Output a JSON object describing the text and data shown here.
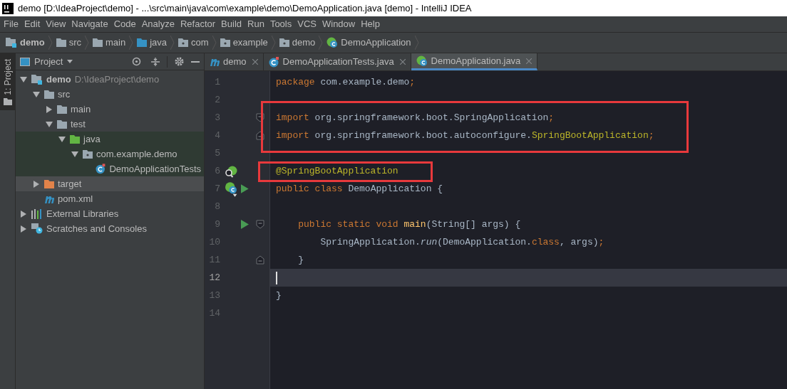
{
  "window": {
    "title": "demo [D:\\IdeaProject\\demo] - ...\\src\\main\\java\\com\\example\\demo\\DemoApplication.java [demo] - IntelliJ IDEA"
  },
  "menu": [
    "File",
    "Edit",
    "View",
    "Navigate",
    "Code",
    "Analyze",
    "Refactor",
    "Build",
    "Run",
    "Tools",
    "VCS",
    "Window",
    "Help"
  ],
  "breadcrumbs": [
    {
      "label": "demo",
      "kind": "module"
    },
    {
      "label": "src",
      "kind": "folder"
    },
    {
      "label": "main",
      "kind": "folder"
    },
    {
      "label": "java",
      "kind": "source"
    },
    {
      "label": "com",
      "kind": "package"
    },
    {
      "label": "example",
      "kind": "package"
    },
    {
      "label": "demo",
      "kind": "package"
    },
    {
      "label": "DemoApplication",
      "kind": "spring-class"
    }
  ],
  "tool_strip": {
    "label": "1: Project"
  },
  "project_panel": {
    "title": "Project",
    "tree": [
      {
        "label": "demo",
        "path": "D:\\IdeaProject\\demo",
        "kind": "module",
        "expanded": true,
        "selected": false,
        "children": [
          {
            "label": "src",
            "kind": "folder",
            "expanded": true,
            "selected": false,
            "children": [
              {
                "label": "main",
                "kind": "folder",
                "expanded": false,
                "selected": false
              },
              {
                "label": "test",
                "kind": "folder",
                "expanded": true,
                "selected": false,
                "children": [
                  {
                    "label": "java",
                    "kind": "test-source",
                    "expanded": true,
                    "selected": false,
                    "children": [
                      {
                        "label": "com.example.demo",
                        "kind": "package",
                        "expanded": true,
                        "selected": false,
                        "children": [
                          {
                            "label": "DemoApplicationTests",
                            "kind": "test-class",
                            "selected": false
                          }
                        ]
                      }
                    ]
                  }
                ]
              }
            ]
          },
          {
            "label": "target",
            "kind": "excluded",
            "expanded": false,
            "selected": true
          },
          {
            "label": "pom.xml",
            "kind": "maven",
            "selected": false
          }
        ]
      },
      {
        "label": "External Libraries",
        "kind": "libraries",
        "expanded": false,
        "selected": false
      },
      {
        "label": "Scratches and Consoles",
        "kind": "scratches",
        "expanded": false,
        "selected": false
      }
    ]
  },
  "editor_tabs": [
    {
      "label": "demo",
      "kind": "maven",
      "selected": false
    },
    {
      "label": "DemoApplicationTests.java",
      "kind": "test-class",
      "selected": false
    },
    {
      "label": "DemoApplication.java",
      "kind": "spring-class",
      "selected": true
    }
  ],
  "code_lines": [
    {
      "number": "1",
      "current": false,
      "boxed": false,
      "tokens": [
        {
          "text": "package",
          "kind": "keyword"
        },
        {
          "text": " com.example.demo",
          "kind": "plain"
        },
        {
          "text": ";",
          "kind": "keyword"
        }
      ]
    },
    {
      "number": "2",
      "current": false,
      "boxed": false
    },
    {
      "number": "3",
      "current": false,
      "boxed": true,
      "gutter": [
        {
          "kind": "fold-start"
        }
      ],
      "tokens": [
        {
          "text": "import",
          "kind": "keyword"
        },
        {
          "text": " org.springframework.boot.SpringApplication",
          "kind": "plain"
        },
        {
          "text": ";",
          "kind": "keyword"
        }
      ]
    },
    {
      "number": "4",
      "current": false,
      "boxed": true,
      "gutter": [
        {
          "kind": "fold-end"
        }
      ],
      "tokens": [
        {
          "text": "import",
          "kind": "keyword"
        },
        {
          "text": " org.springframework.boot.autoconfigure.",
          "kind": "plain"
        },
        {
          "text": "SpringBootApplication",
          "kind": "annotation"
        },
        {
          "text": ";",
          "kind": "keyword"
        }
      ]
    },
    {
      "number": "5",
      "current": false,
      "boxed": false
    },
    {
      "number": "6",
      "current": false,
      "boxed": true,
      "gutter": [
        {
          "kind": "bean-search"
        }
      ],
      "tokens": [
        {
          "text": "@SpringBootApplication",
          "kind": "annotation"
        }
      ]
    },
    {
      "number": "7",
      "current": false,
      "boxed": false,
      "gutter": [
        {
          "kind": "bean-class"
        },
        {
          "kind": "run"
        }
      ],
      "tokens": [
        {
          "text": "public class",
          "kind": "keyword"
        },
        {
          "text": " DemoApplication {",
          "kind": "plain"
        }
      ]
    },
    {
      "number": "8",
      "current": false,
      "boxed": false
    },
    {
      "number": "9",
      "current": false,
      "boxed": false,
      "gutter": [
        {
          "kind": "run"
        },
        {
          "kind": "fold-start"
        }
      ],
      "tokens": [
        {
          "text": "    public static void",
          "kind": "keyword"
        },
        {
          "text": " main",
          "kind": "method"
        },
        {
          "text": "(String[] args) {",
          "kind": "plain"
        }
      ]
    },
    {
      "number": "10",
      "current": false,
      "boxed": false,
      "tokens": [
        {
          "text": "        SpringApplication.",
          "kind": "plain"
        },
        {
          "text": "run",
          "kind": "static-call"
        },
        {
          "text": "(DemoApplication.",
          "kind": "plain"
        },
        {
          "text": "class",
          "kind": "keyword"
        },
        {
          "text": ", args)",
          "kind": "plain"
        },
        {
          "text": ";",
          "kind": "keyword"
        }
      ]
    },
    {
      "number": "11",
      "current": false,
      "boxed": false,
      "gutter": [
        {
          "kind": "fold-end"
        }
      ],
      "tokens": [
        {
          "text": "    }",
          "kind": "plain"
        }
      ]
    },
    {
      "number": "12",
      "current": true,
      "boxed": false
    },
    {
      "number": "13",
      "current": false,
      "boxed": false,
      "tokens": [
        {
          "text": "}",
          "kind": "plain"
        }
      ]
    },
    {
      "number": "14",
      "current": false,
      "boxed": false
    }
  ]
}
